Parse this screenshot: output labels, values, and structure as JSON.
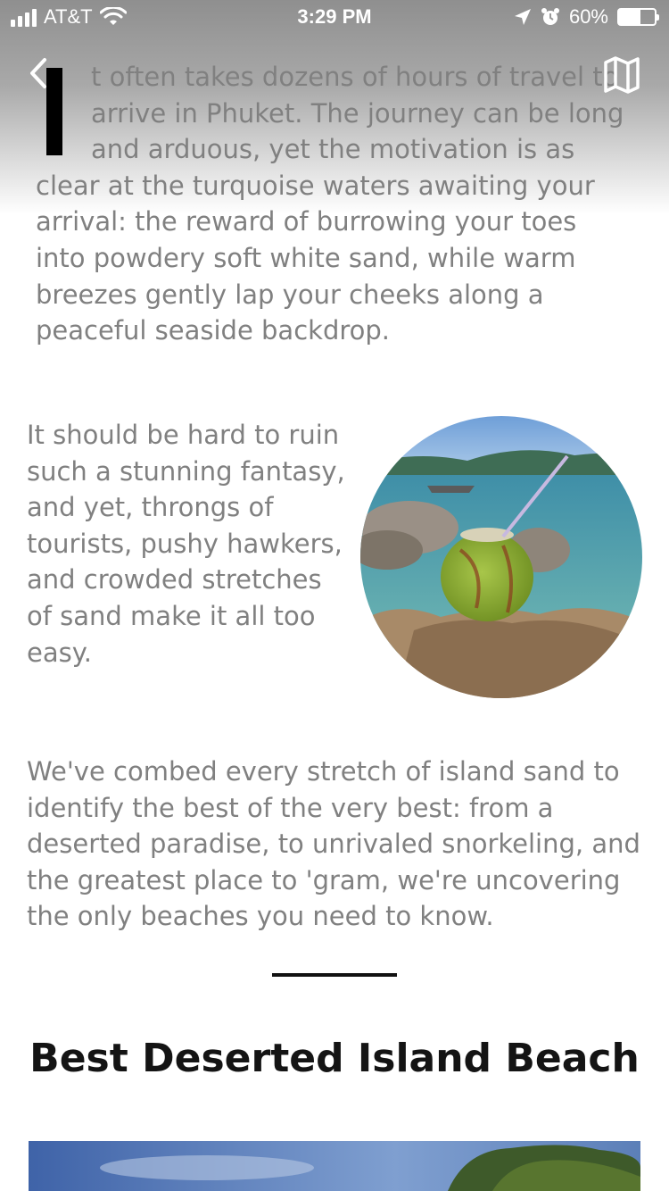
{
  "status_bar": {
    "carrier": "AT&T",
    "time": "3:29 PM",
    "battery_percent": "60%",
    "battery_level": 0.6
  },
  "nav": {
    "back_icon": "chevron-left-icon",
    "map_icon": "map-icon"
  },
  "article": {
    "intro_drop_cap": "I",
    "intro_text": "t often takes dozens of hours of travel to arrive in Phuket. The journey can be long and arduous, yet the motivation is as clear at the turquoise waters awaiting your arrival: the reward of burrowing your toes into powdery soft white sand, while warm breezes gently lap your cheeks along a peaceful seaside backdrop.",
    "paragraph_2": "It should be hard to ruin such a stunning fantasy, and yet, throngs of tourists, pushy hawkers, and crowded stretches of sand make it all too easy.",
    "paragraph_3": "We've combed every stretch of island sand to identify the best of the very best: from a deserted paradise, to unrivaled snorkeling, and the greatest place to 'gram, we're uncovering the only beaches you need to know.",
    "section_title": "Best Deserted Island Beach"
  },
  "colors": {
    "body_text": "#808080",
    "heading": "#141414",
    "accent_black": "#000000"
  }
}
